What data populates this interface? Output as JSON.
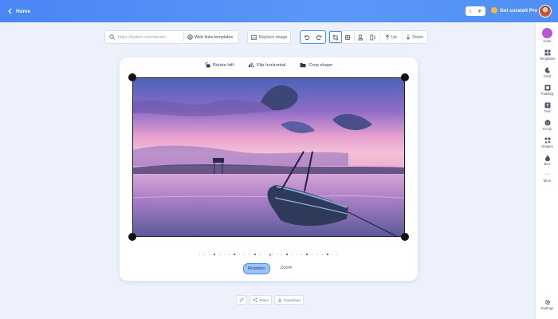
{
  "topbar": {
    "home_label": "Home",
    "pro_label": "Get curateit Pro"
  },
  "toolbar": {
    "url_placeholder": "https://twitter.com/savani...",
    "web_links_templates": "Web links templates",
    "replace_image": "Replace image",
    "up": "Up",
    "down": "Down"
  },
  "card": {
    "rotate_left": "Rotate left",
    "flip_horizontal": "Flip horizontal",
    "crop_shape": "Crop shape",
    "rotation_degree": "0°",
    "tab_rotation": "Rotation",
    "tab_zoom": "Zoom"
  },
  "bottom": {
    "share": "Share",
    "download": "Download"
  },
  "sidebar": {
    "items": [
      {
        "label": "Color",
        "icon": "color-swatch-icon"
      },
      {
        "label": "Templates",
        "icon": "grid-icon"
      },
      {
        "label": "Card",
        "icon": "moon-icon"
      },
      {
        "label": "Padding",
        "icon": "padding-icon"
      },
      {
        "label": "Text",
        "icon": "text-icon"
      },
      {
        "label": "Emoji",
        "icon": "emoji-icon"
      },
      {
        "label": "Shapes",
        "icon": "shapes-icon"
      },
      {
        "label": "Blur",
        "icon": "blur-icon"
      },
      {
        "label": "More",
        "icon": "more-icon"
      },
      {
        "label": "Settings",
        "icon": "gear-icon"
      }
    ]
  },
  "colors": {
    "accent": "#4a8df8",
    "topbar": "#4f8ff6",
    "swatch": "#b45ad7"
  }
}
